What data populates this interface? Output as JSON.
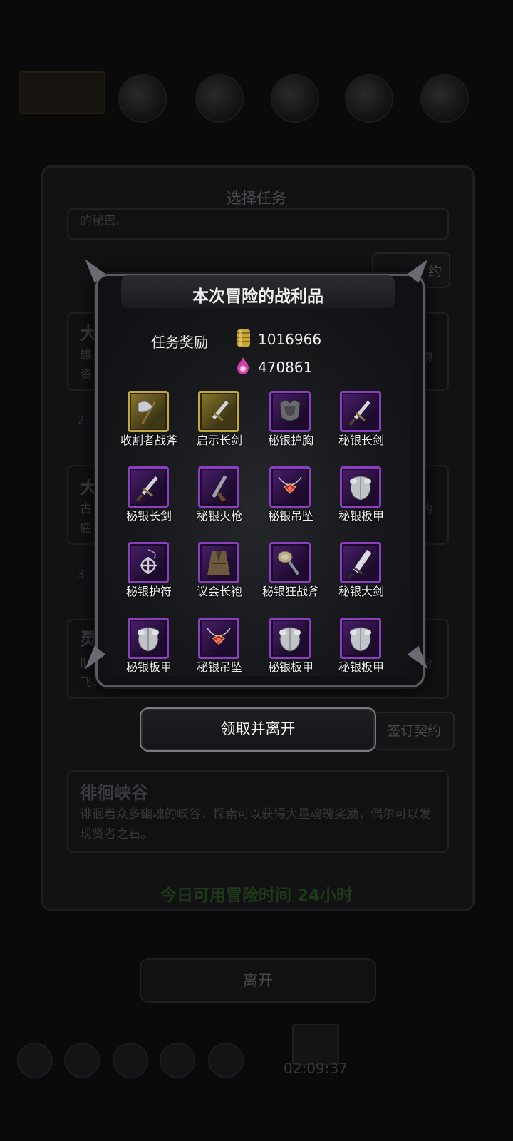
{
  "background": {
    "panel_title": "选择任务",
    "card1_desc": "的秘密。",
    "card2_title": "大",
    "card2_desc_1": "雄",
    "card2_desc_2": "资",
    "card2_right_1": "物",
    "card2_num": "2",
    "card3_title": "大",
    "card3_desc_1": "古",
    "card3_desc_2": "底",
    "card3_right": "的",
    "card3_num": "3",
    "card4_title": "灵",
    "card4_desc_1": "旧",
    "card4_desc_2": "飞。",
    "card4_right": "纷",
    "side_btn_1": "约",
    "sign_contract": "签订契约",
    "valley_title": "徘徊峡谷",
    "valley_desc": "徘徊着众多幽魂的峡谷，探索可以获得大量魂魄奖励，偶尔可以发现贤者之石。",
    "time_text": "今日可用冒险时间 24小时",
    "leave_button": "离开",
    "timer": "02:09:37"
  },
  "modal": {
    "title": "本次冒险的战利品",
    "reward_label": "任务奖励",
    "gold": "1016966",
    "souls": "470861",
    "gold_icon": "gold-coins-icon",
    "soul_icon": "soul-flame-icon",
    "items": [
      {
        "name": "收割者战斧",
        "rarity": "gold",
        "icon": "battle-axe-icon"
      },
      {
        "name": "启示长剑",
        "rarity": "gold",
        "icon": "longsword-icon"
      },
      {
        "name": "秘银护胸",
        "rarity": "purple",
        "icon": "chestplate-icon"
      },
      {
        "name": "秘银长剑",
        "rarity": "purple",
        "icon": "longsword-icon"
      },
      {
        "name": "秘银长剑",
        "rarity": "purple",
        "icon": "longsword-icon"
      },
      {
        "name": "秘银火枪",
        "rarity": "purple",
        "icon": "musket-icon"
      },
      {
        "name": "秘银吊坠",
        "rarity": "purple",
        "icon": "pendant-icon"
      },
      {
        "name": "秘银板甲",
        "rarity": "purple",
        "icon": "plate-armor-icon"
      },
      {
        "name": "秘银护符",
        "rarity": "purple",
        "icon": "amulet-icon"
      },
      {
        "name": "议会长袍",
        "rarity": "purple",
        "icon": "robe-icon"
      },
      {
        "name": "秘银狂战斧",
        "rarity": "purple",
        "icon": "berserker-axe-icon"
      },
      {
        "name": "秘银大剑",
        "rarity": "purple",
        "icon": "greatsword-icon"
      },
      {
        "name": "秘银板甲",
        "rarity": "purple",
        "icon": "plate-armor-icon"
      },
      {
        "name": "秘银吊坠",
        "rarity": "purple",
        "icon": "pendant-icon"
      },
      {
        "name": "秘银板甲",
        "rarity": "purple",
        "icon": "plate-armor-icon"
      },
      {
        "name": "秘银板甲",
        "rarity": "purple",
        "icon": "plate-armor-icon"
      }
    ],
    "claim_button": "领取并离开"
  },
  "colors": {
    "gold_frame": "#c4a93a",
    "purple_frame": "#8a3fc0",
    "time_green": "#1e3a18"
  }
}
